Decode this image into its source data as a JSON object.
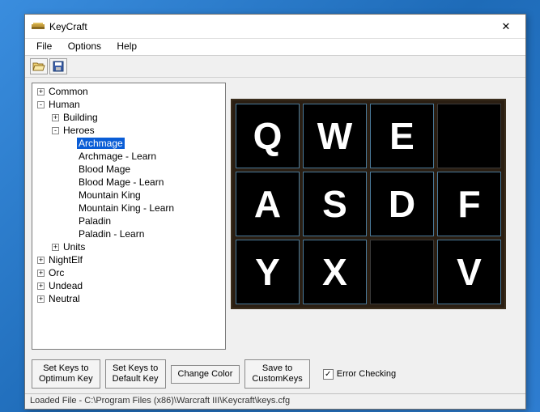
{
  "window": {
    "title": "KeyCraft",
    "close": "✕"
  },
  "menu": {
    "file": "File",
    "options": "Options",
    "help": "Help"
  },
  "toolbar": {
    "open": "open-icon",
    "save": "save-icon"
  },
  "tree": [
    {
      "level": 0,
      "expand": "+",
      "label": "Common",
      "bindKey": "t0"
    },
    {
      "level": 0,
      "expand": "-",
      "label": "Human",
      "bindKey": "t1"
    },
    {
      "level": 1,
      "expand": "+",
      "label": "Building",
      "bindKey": "t2"
    },
    {
      "level": 1,
      "expand": "-",
      "label": "Heroes",
      "bindKey": "t3"
    },
    {
      "level": 2,
      "expand": "",
      "label": "Archmage",
      "selected": true,
      "bindKey": "t4"
    },
    {
      "level": 2,
      "expand": "",
      "label": "Archmage - Learn",
      "bindKey": "t5"
    },
    {
      "level": 2,
      "expand": "",
      "label": "Blood Mage",
      "bindKey": "t6"
    },
    {
      "level": 2,
      "expand": "",
      "label": "Blood Mage - Learn",
      "bindKey": "t7"
    },
    {
      "level": 2,
      "expand": "",
      "label": "Mountain King",
      "bindKey": "t8"
    },
    {
      "level": 2,
      "expand": "",
      "label": "Mountain King - Learn",
      "bindKey": "t9"
    },
    {
      "level": 2,
      "expand": "",
      "label": "Paladin",
      "bindKey": "t10"
    },
    {
      "level": 2,
      "expand": "",
      "label": "Paladin - Learn",
      "bindKey": "t11"
    },
    {
      "level": 1,
      "expand": "+",
      "label": "Units",
      "bindKey": "t12"
    },
    {
      "level": 0,
      "expand": "+",
      "label": "NightElf",
      "bindKey": "t13"
    },
    {
      "level": 0,
      "expand": "+",
      "label": "Orc",
      "bindKey": "t14"
    },
    {
      "level": 0,
      "expand": "+",
      "label": "Undead",
      "bindKey": "t15"
    },
    {
      "level": 0,
      "expand": "+",
      "label": "Neutral",
      "bindKey": "t16"
    }
  ],
  "tree_labels": {
    "t0": "Common",
    "t1": "Human",
    "t2": "Building",
    "t3": "Heroes",
    "t4": "Archmage",
    "t5": "Archmage - Learn",
    "t6": "Blood Mage",
    "t7": "Blood Mage - Learn",
    "t8": "Mountain King",
    "t9": "Mountain King - Learn",
    "t10": "Paladin",
    "t11": "Paladin - Learn",
    "t12": "Units",
    "t13": "NightElf",
    "t14": "Orc",
    "t15": "Undead",
    "t16": "Neutral"
  },
  "grid": {
    "cells": [
      "Q",
      "W",
      "E",
      "",
      "A",
      "S",
      "D",
      "F",
      "Y",
      "X",
      "",
      "V"
    ]
  },
  "buttons": {
    "optimum": "Set Keys to\nOptimum Key",
    "default": "Set Keys to\nDefault Key",
    "color": "Change Color",
    "save": "Save to\nCustomKeys"
  },
  "checkbox": {
    "error_checking": "Error Checking",
    "checked": "✓"
  },
  "status": "Loaded File - C:\\Program Files (x86)\\Warcraft III\\Keycraft\\keys.cfg"
}
